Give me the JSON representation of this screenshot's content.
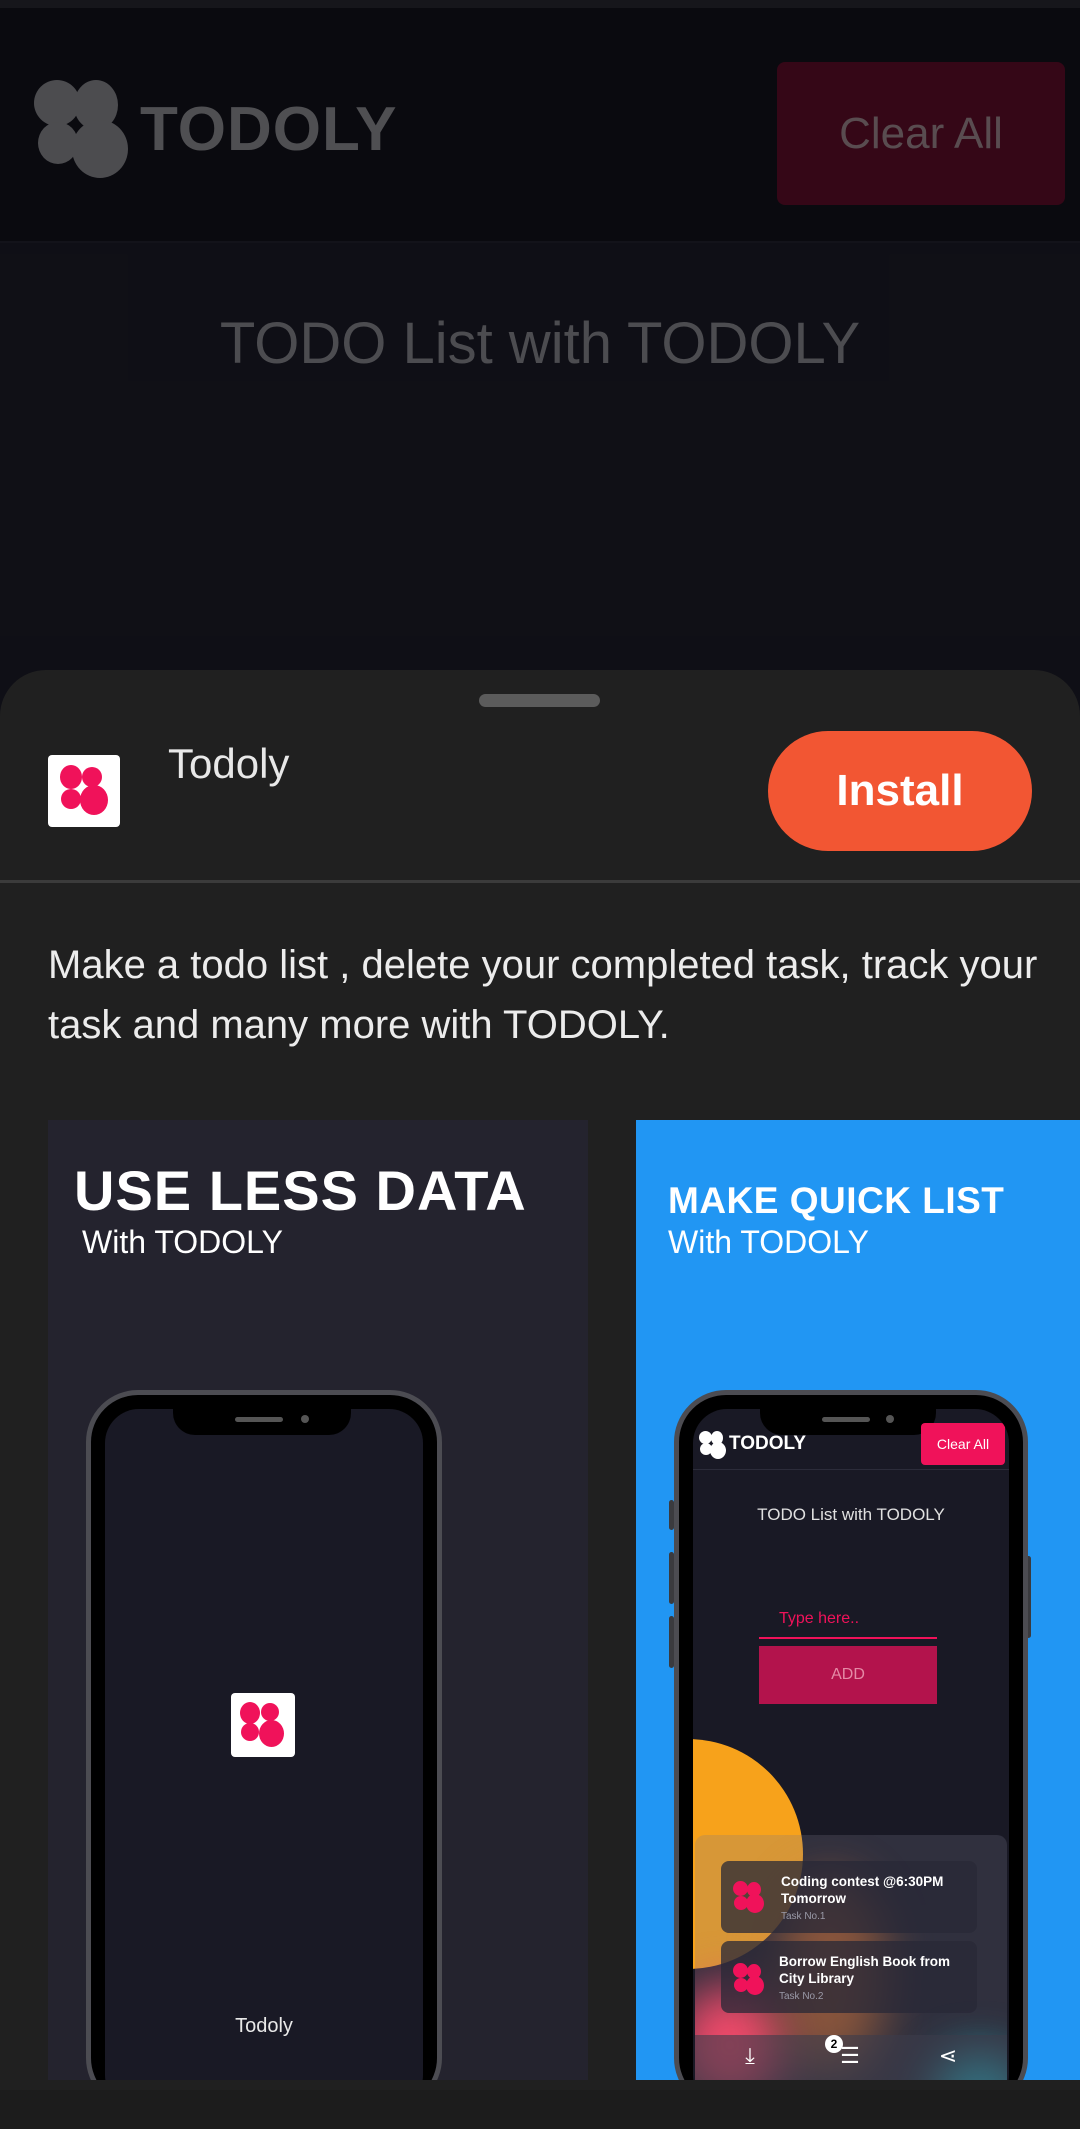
{
  "app_page": {
    "brand": "TODOLY",
    "clear_all_label": "Clear All",
    "title": "TODO List with TODOLY"
  },
  "install_sheet": {
    "app_name": "Todoly",
    "install_label": "Install",
    "description": "Make a todo list , delete your completed task, track your task and many more with TODOLY.",
    "screenshots": [
      {
        "headline": "USE LESS DATA",
        "subline": "With TODOLY",
        "splash_name": "Todoly",
        "background": "#24232e"
      },
      {
        "headline": "MAKE QUICK LIST",
        "subline": "With TODOLY",
        "background": "#2196f3",
        "mini_app": {
          "brand": "TODOLY",
          "clear_all_label": "Clear All",
          "title": "TODO List with TODOLY",
          "input_placeholder": "Type here..",
          "add_label": "ADD",
          "tasks": [
            {
              "text": "Coding contest @6:30PM Tomorrow",
              "sub": "Task No.1"
            },
            {
              "text": "Borrow English Book from City Library",
              "sub": "Task No.2"
            }
          ],
          "tabbar_badge": "2",
          "tab_icons": [
            "download-icon",
            "list-icon",
            "share-icon"
          ]
        }
      }
    ]
  },
  "colors": {
    "accent": "#f0125a",
    "install": "#f25633",
    "sheet_bg": "#202020"
  }
}
